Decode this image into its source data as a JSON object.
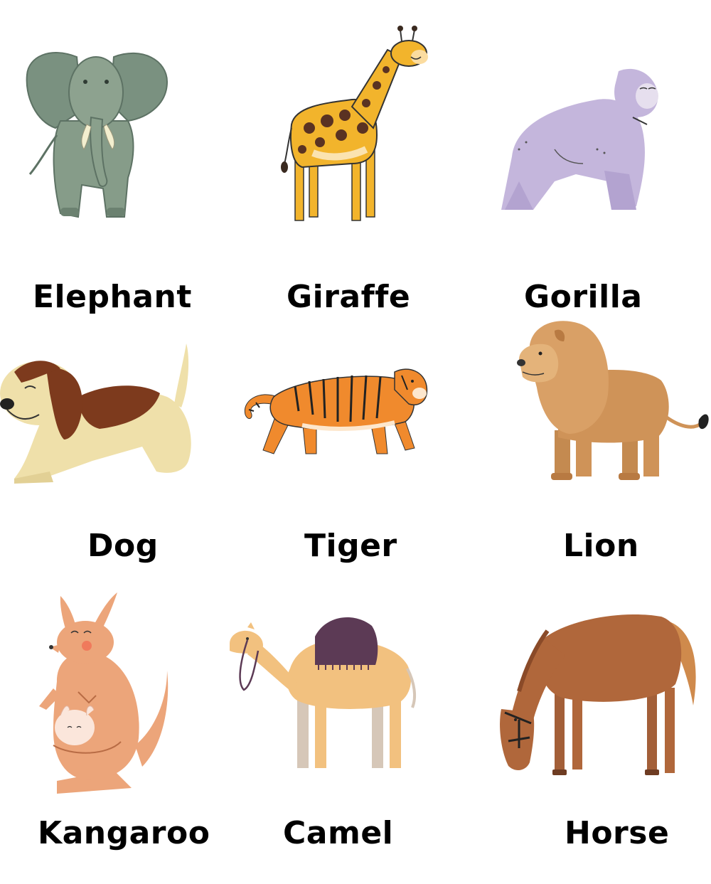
{
  "animals": [
    {
      "name": "Elephant",
      "icon": "elephant-icon",
      "color": "#7f9683"
    },
    {
      "name": "Giraffe",
      "icon": "giraffe-icon",
      "color": "#f2b42c"
    },
    {
      "name": "Gorilla",
      "icon": "gorilla-icon",
      "color": "#c4b6dc"
    },
    {
      "name": "Dog",
      "icon": "dog-icon",
      "color": "#efe0aa"
    },
    {
      "name": "Tiger",
      "icon": "tiger-icon",
      "color": "#f08a2d"
    },
    {
      "name": "Lion",
      "icon": "lion-icon",
      "color": "#cf9358"
    },
    {
      "name": "Kangaroo",
      "icon": "kangaroo-icon",
      "color": "#eca57a"
    },
    {
      "name": "Camel",
      "icon": "camel-icon",
      "color": "#f2c17f"
    },
    {
      "name": "Horse",
      "icon": "horse-icon",
      "color": "#b0673b"
    }
  ]
}
